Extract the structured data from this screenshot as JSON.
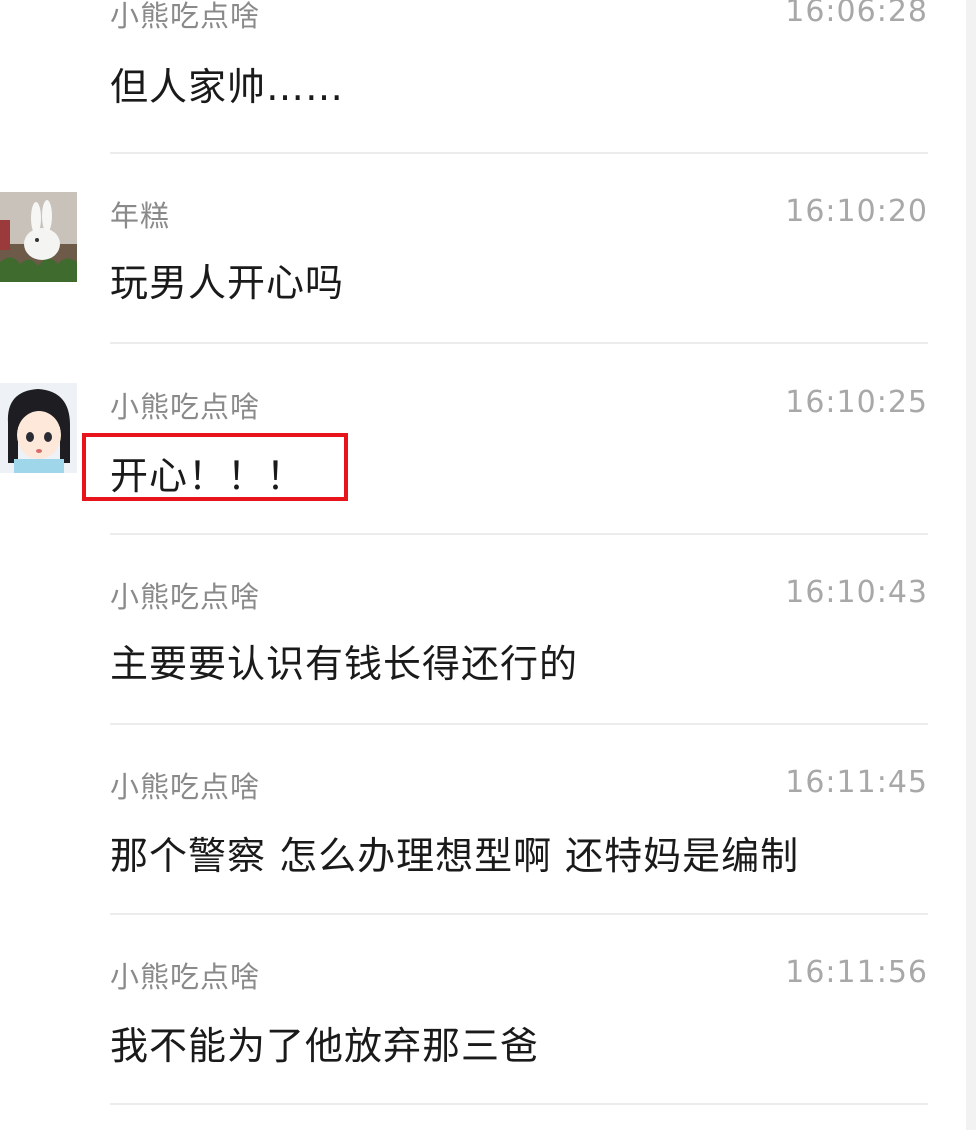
{
  "messages": [
    {
      "sender": "小熊吃点啥",
      "time": "16:06:28",
      "text": "但人家帅……",
      "avatar": "none"
    },
    {
      "sender": "年糕",
      "time": "16:10:20",
      "text": "玩男人开心吗",
      "avatar": "rabbit-avatar"
    },
    {
      "sender": "小熊吃点啥",
      "time": "16:10:25",
      "text": "开心！！！",
      "avatar": "anime-girl-avatar"
    },
    {
      "sender": "小熊吃点啥",
      "time": "16:10:43",
      "text": "主要要认识有钱长得还行的",
      "avatar": "none"
    },
    {
      "sender": "小熊吃点啥",
      "time": "16:11:45",
      "text": "那个警察 怎么办理想型啊 还特妈是编制",
      "avatar": "none"
    },
    {
      "sender": "小熊吃点啥",
      "time": "16:11:56",
      "text": "我不能为了他放弃那三爸",
      "avatar": "none"
    }
  ],
  "highlight": {
    "color": "#e8141b"
  },
  "colors": {
    "sender": "#8a8a8a",
    "time": "#a8a8a8",
    "text": "#1a1a1a",
    "divider": "#ececec"
  }
}
